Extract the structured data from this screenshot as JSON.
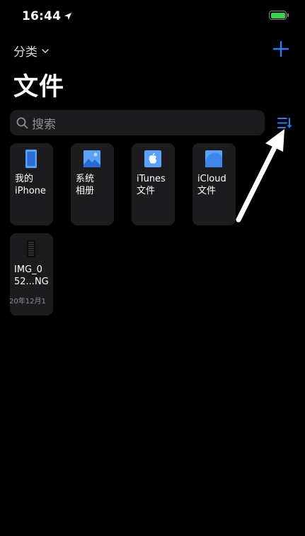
{
  "status_bar": {
    "time": "16:44",
    "battery_level": 1.0,
    "battery_color": "#32d74b"
  },
  "header": {
    "category_label": "分类",
    "title": "文件",
    "accent_color": "#2f7cf6"
  },
  "search": {
    "placeholder": "搜索"
  },
  "locations": [
    {
      "icon": "iphone-icon",
      "label": "我的\niPhone"
    },
    {
      "icon": "photo-album-icon",
      "label": "系统\n相册"
    },
    {
      "icon": "apple-icon",
      "label": "iTunes\n文件"
    },
    {
      "icon": "cloud-icon",
      "label": "iCloud\n文件"
    }
  ],
  "files": [
    {
      "icon": "image-file-icon",
      "name": "IMG_0\n52...NG",
      "date": "20年12月1"
    }
  ]
}
